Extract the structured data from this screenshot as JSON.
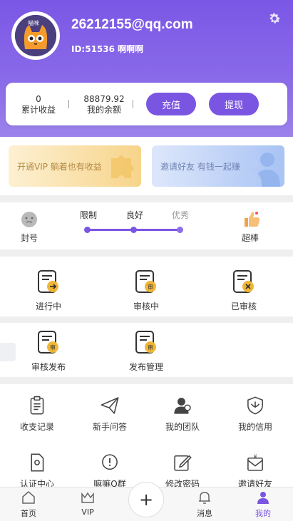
{
  "profile": {
    "email": "26212155@qq.com",
    "id_text": "ID:51536 啊啊啊",
    "avatar_label": "喵咪"
  },
  "stats": {
    "income_value": "0",
    "income_label": "累计收益",
    "balance_value": "88879.92",
    "balance_label": "我的余额"
  },
  "actions": {
    "recharge": "充值",
    "withdraw": "提现"
  },
  "banners": {
    "vip": "开通VIP 躺着也有收益",
    "invite": "邀请好友 有钱一起赚"
  },
  "level": {
    "left_label": "封号",
    "right_label": "超棒",
    "steps": [
      "限制",
      "良好",
      "优秀"
    ]
  },
  "tasks": {
    "in_progress": "进行中",
    "reviewing": "审核中",
    "reviewed": "已审核",
    "review_publish": "审核发布",
    "publish_manage": "发布管理"
  },
  "menu": {
    "records": "收支记录",
    "faq": "新手问答",
    "team": "我的团队",
    "credit": "我的信用",
    "verify": "认证中心",
    "support": "嘛嘛Q群",
    "password": "修改密码",
    "invite": "邀请好友"
  },
  "tabbar": {
    "home": "首页",
    "vip": "VIP",
    "plus": "+",
    "messages": "消息",
    "mine": "我的"
  },
  "colors": {
    "primary": "#7a55e2",
    "accent": "#e9b43c"
  }
}
